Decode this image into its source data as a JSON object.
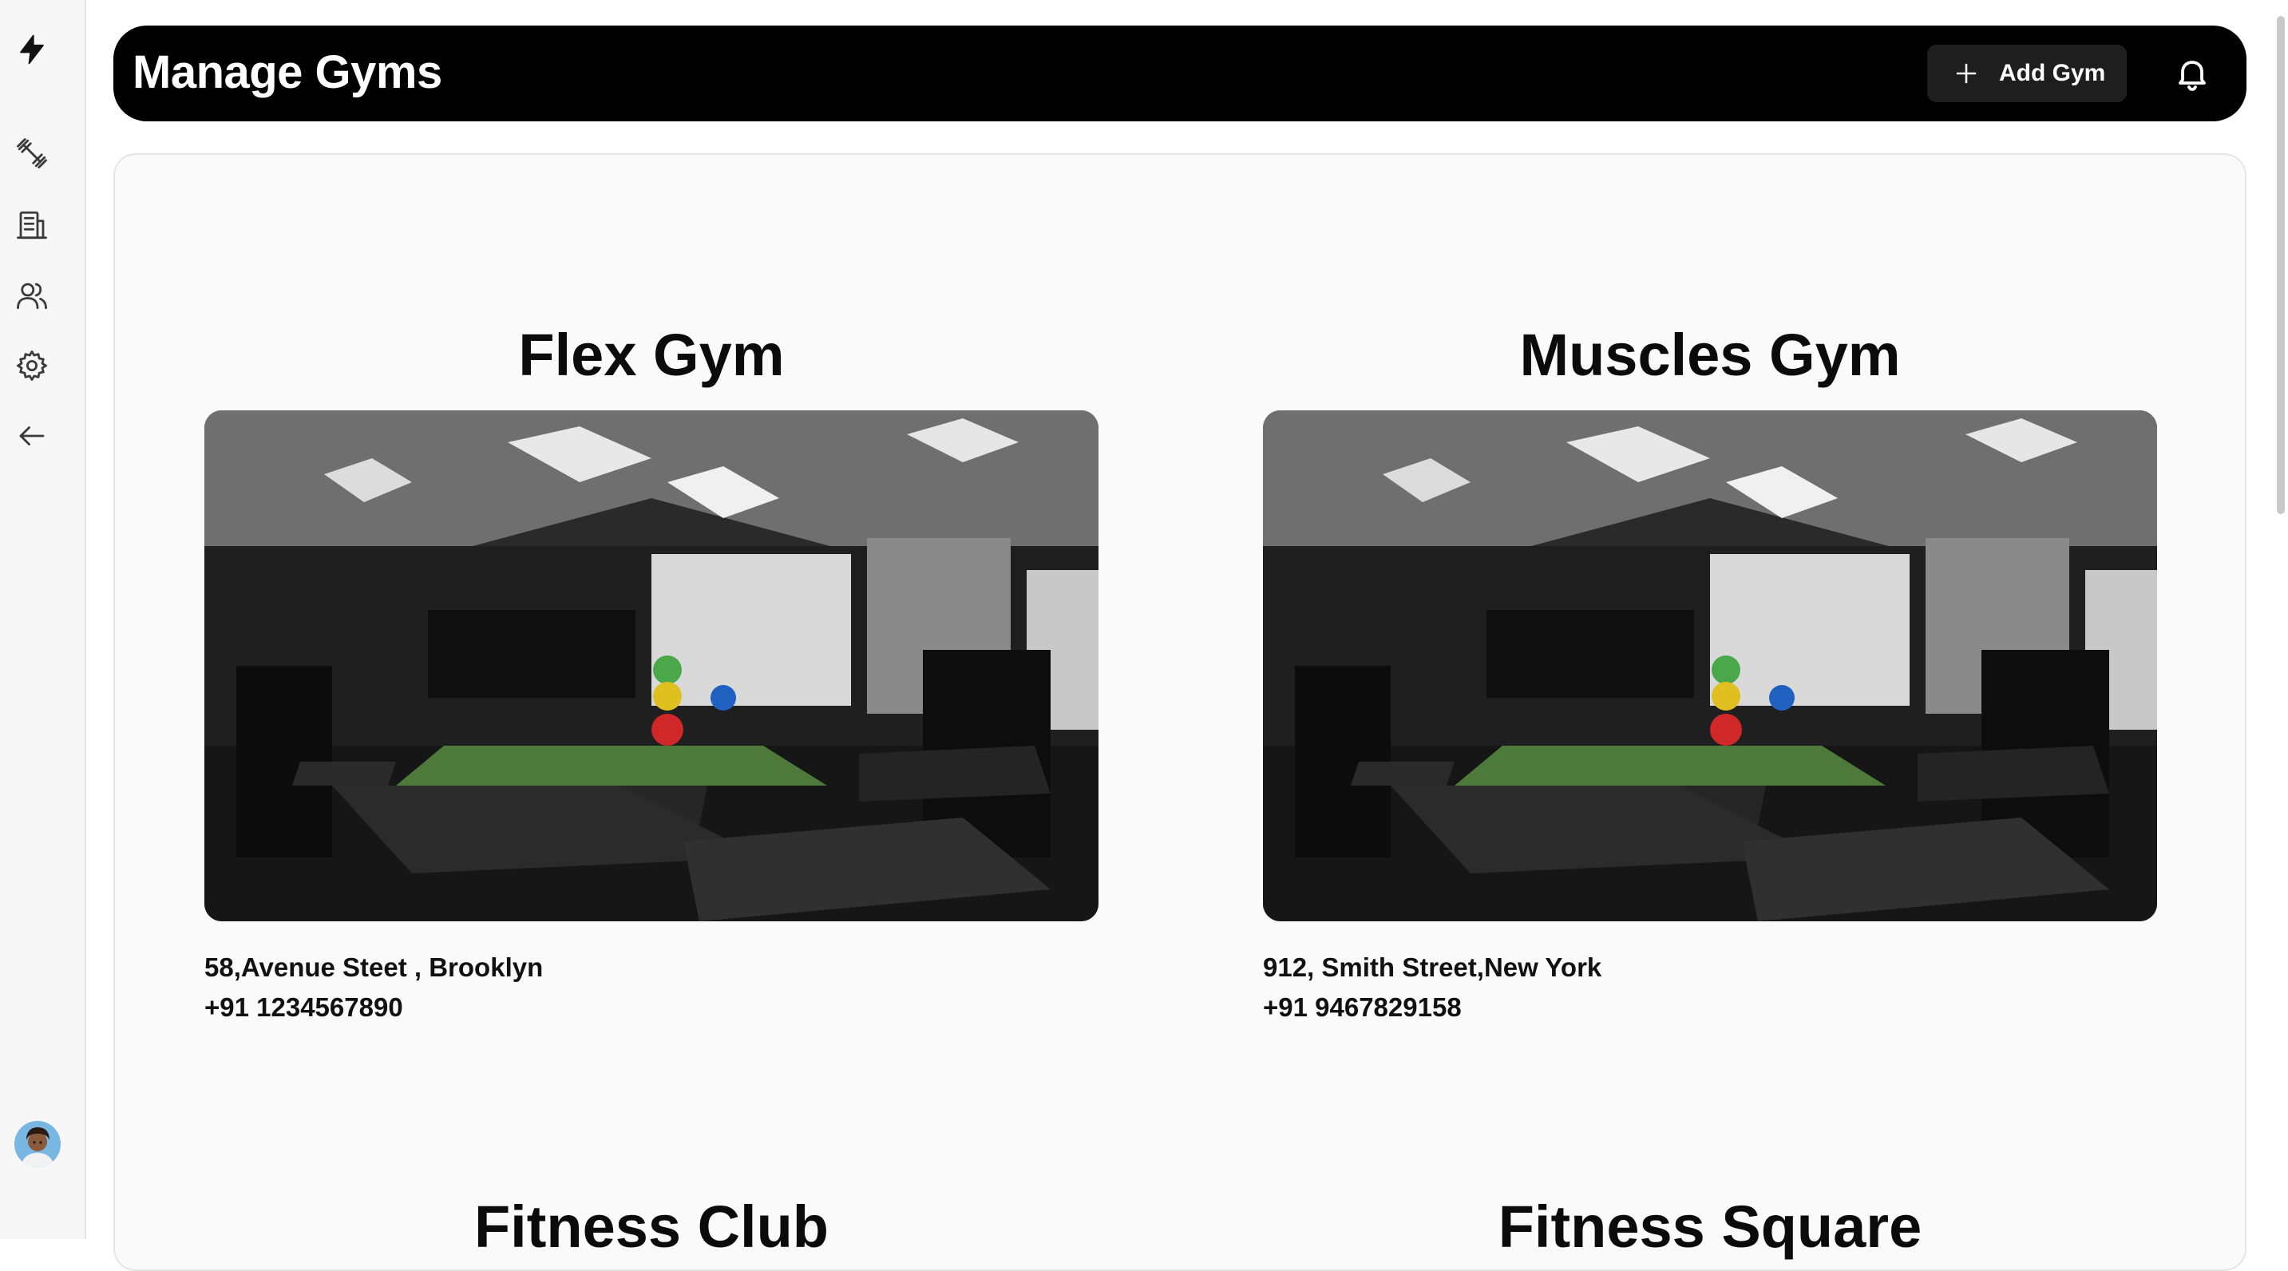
{
  "sidebar": {
    "items": [
      {
        "icon": "bolt-logo-icon"
      },
      {
        "icon": "dumbbell-icon"
      },
      {
        "icon": "building-icon"
      },
      {
        "icon": "users-icon"
      },
      {
        "icon": "gear-icon"
      },
      {
        "icon": "arrow-left-icon"
      }
    ],
    "avatar": "user-avatar"
  },
  "header": {
    "title": "Manage Gyms",
    "add_button_label": "Add Gym",
    "add_button_icon": "plus-icon",
    "notification_icon": "bell-icon"
  },
  "gyms": [
    {
      "name": "Flex Gym",
      "address": "58,Avenue Steet , Brooklyn",
      "phone": "+91 1234567890"
    },
    {
      "name": "Muscles Gym",
      "address": "912, Smith Street,New York",
      "phone": "+91 9467829158"
    },
    {
      "name": "Fitness Club",
      "address": "",
      "phone": ""
    },
    {
      "name": "Fitness Square",
      "address": "",
      "phone": ""
    }
  ],
  "colors": {
    "header_bg": "#000000",
    "button_bg": "#1e1e1e",
    "content_bg": "#fafafa",
    "sidebar_bg": "#f7f7f7"
  }
}
